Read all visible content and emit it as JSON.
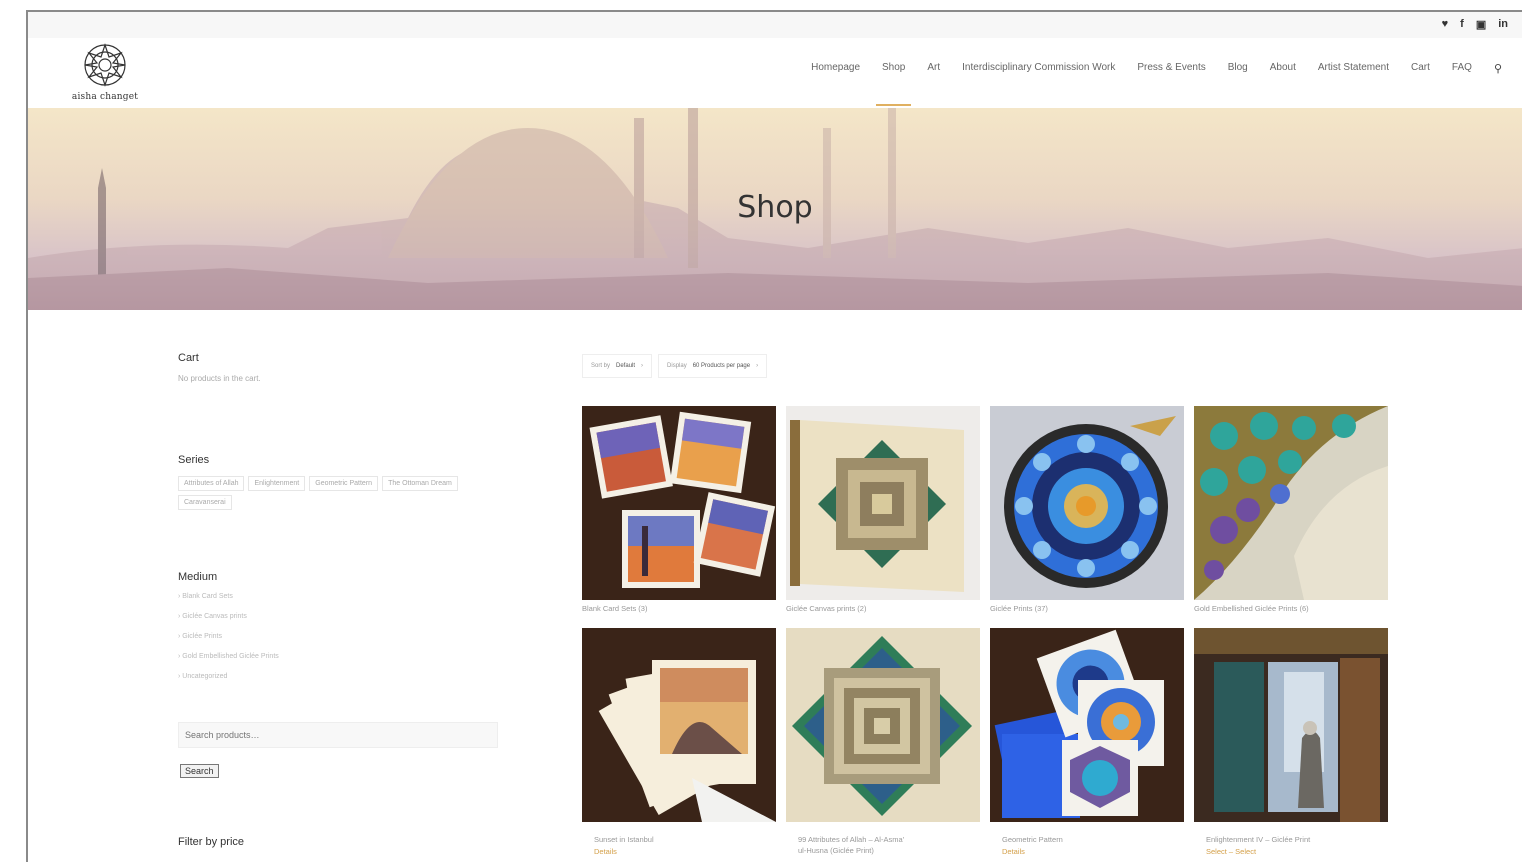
{
  "social": {
    "icons": [
      "twitter-icon",
      "facebook-icon",
      "instagram-icon",
      "linkedin-icon"
    ],
    "glyphs": [
      "❤",
      "f",
      "▣",
      "in"
    ]
  },
  "header": {
    "logo_text": "aisha changet",
    "nav": [
      "Homepage",
      "Shop",
      "Art",
      "Interdisciplinary Commission Work",
      "Press & Events",
      "Blog",
      "About",
      "Artist Statement",
      "Cart",
      "FAQ"
    ],
    "active_index": 1
  },
  "banner": {
    "title": "Shop"
  },
  "sidebar": {
    "cart_title": "Cart",
    "cart_text": "No products in the cart.",
    "series_title": "Series",
    "series_tags": [
      "Attributes of Allah",
      "Enlightenment",
      "Geometric Pattern",
      "The Ottoman Dream",
      "Caravanserai"
    ],
    "medium_title": "Medium",
    "medium_items": [
      "Blank Card Sets",
      "Giclée Canvas prints",
      "Giclée Prints",
      "Gold Embellished Giclée Prints",
      "Uncategorized"
    ],
    "search_placeholder": "Search products…",
    "search_button": "Search",
    "filter_title": "Filter by price"
  },
  "sort": {
    "sort_prefix": "Sort by",
    "sort_value": "Default",
    "display_prefix": "Display",
    "display_value": "60 Products per page"
  },
  "products_row1": [
    {
      "caption": "Blank Card Sets (3)"
    },
    {
      "caption": "Giclée Canvas prints (2)"
    },
    {
      "caption": "Giclée Prints (37)"
    },
    {
      "caption": "Gold Embellished Giclée Prints (6)"
    }
  ],
  "products_row2": [
    {
      "caption": "Sunset in Istanbul",
      "price": "Details"
    },
    {
      "caption": "99 Attributes of Allah – Al-Asma'",
      "caption_line2": "ul-Husna (Giclée Print)"
    },
    {
      "caption": "Geometric Pattern",
      "price": "Details"
    },
    {
      "caption": "Enlightenment IV – Giclée Print",
      "price": "Select – Select"
    }
  ]
}
